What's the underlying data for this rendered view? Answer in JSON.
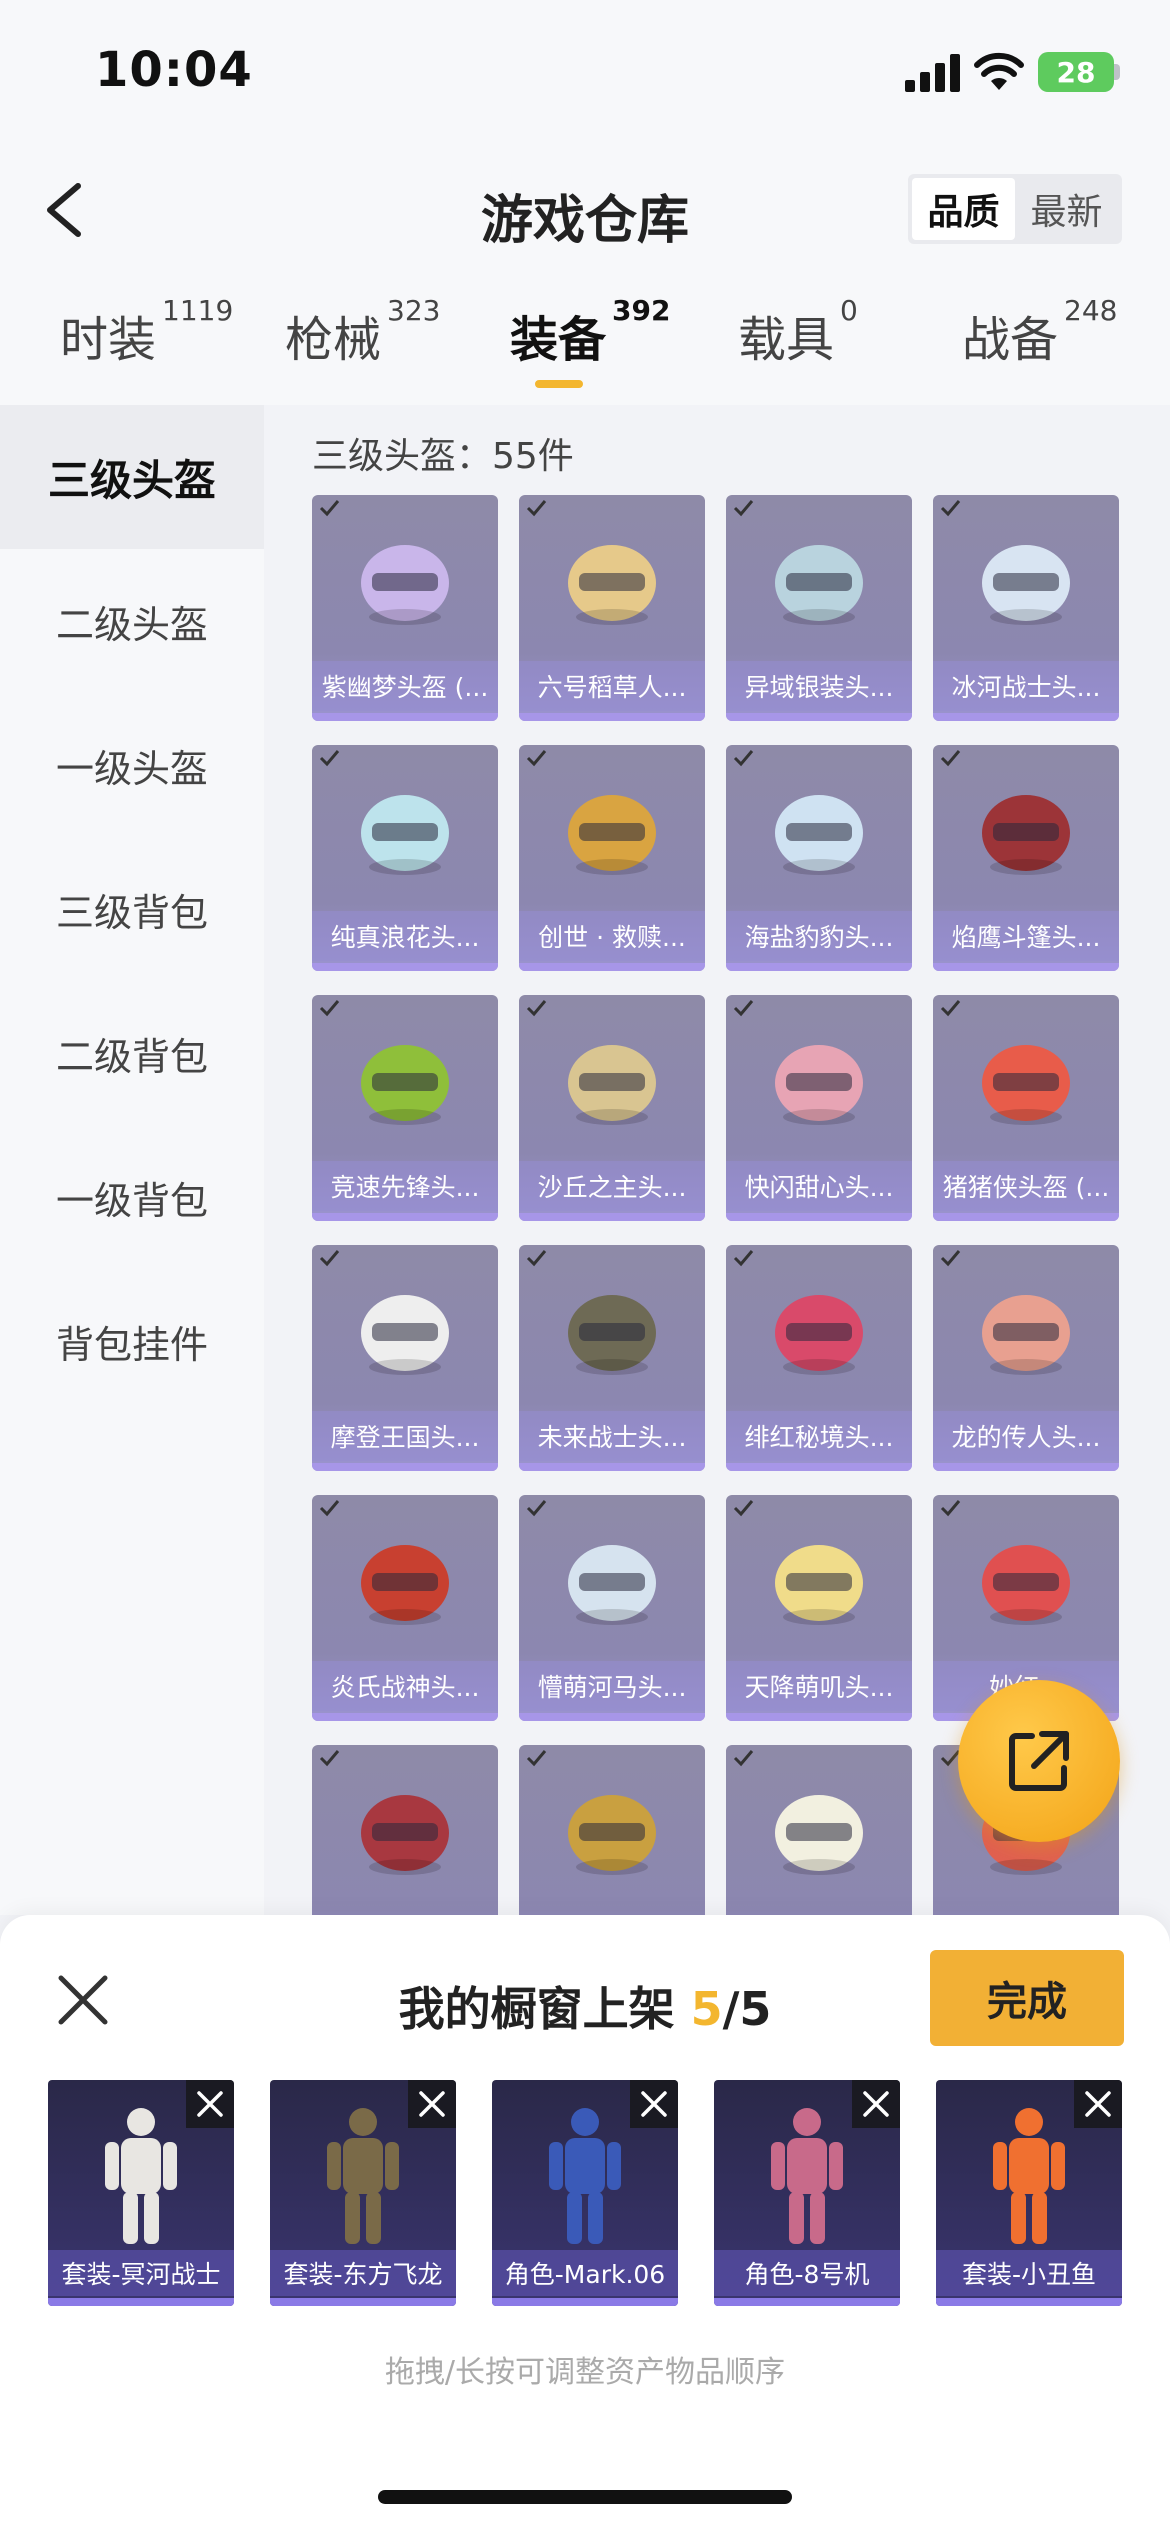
{
  "status": {
    "time": "10:04",
    "battery": "28"
  },
  "nav": {
    "title": "游戏仓库",
    "sort_options": [
      "品质",
      "最新"
    ]
  },
  "tabs": [
    {
      "label": "时装",
      "count": "1119"
    },
    {
      "label": "枪械",
      "count": "323"
    },
    {
      "label": "装备",
      "count": "392"
    },
    {
      "label": "载具",
      "count": "0"
    },
    {
      "label": "战备",
      "count": "248"
    }
  ],
  "sidebar": {
    "items": [
      "三级头盔",
      "二级头盔",
      "一级头盔",
      "三级背包",
      "二级背包",
      "一级背包",
      "背包挂件"
    ]
  },
  "content": {
    "header": "三级头盔：55件",
    "items": [
      {
        "label": "紫幽梦头盔 (...",
        "color": "#c9b6ea"
      },
      {
        "label": "六号稻草人...",
        "color": "#e6c98a"
      },
      {
        "label": "异域银装头...",
        "color": "#b9d3de"
      },
      {
        "label": "冰河战士头...",
        "color": "#d8e4f2"
      },
      {
        "label": "纯真浪花头...",
        "color": "#bde3ec"
      },
      {
        "label": "创世 · 救赎...",
        "color": "#d9a441"
      },
      {
        "label": "海盐豹豹头...",
        "color": "#cfe2f2"
      },
      {
        "label": "焰鹰斗篷头...",
        "color": "#9c3438"
      },
      {
        "label": "竞速先锋头...",
        "color": "#8fbf3a"
      },
      {
        "label": "沙丘之主头...",
        "color": "#d9c591"
      },
      {
        "label": "快闪甜心头...",
        "color": "#e7a4b4"
      },
      {
        "label": "猪猪侠头盔 (...",
        "color": "#e85c4a"
      },
      {
        "label": "摩登王国头...",
        "color": "#eeeeee"
      },
      {
        "label": "未来战士头...",
        "color": "#6e6a55"
      },
      {
        "label": "绯红秘境头...",
        "color": "#d94a6a"
      },
      {
        "label": "龙的传人头...",
        "color": "#e8a090"
      },
      {
        "label": "炎氏战神头...",
        "color": "#c84030"
      },
      {
        "label": "懵萌河马头...",
        "color": "#d6e3ef"
      },
      {
        "label": "天降萌叽头...",
        "color": "#f0dc8a"
      },
      {
        "label": "妙红...",
        "color": "#e05050"
      },
      {
        "label": "",
        "color": "#a83840"
      },
      {
        "label": "",
        "color": "#c9a040"
      },
      {
        "label": "",
        "color": "#f2f0e0"
      },
      {
        "label": "",
        "color": "#e06050"
      }
    ]
  },
  "sheet": {
    "title": "我的橱窗上架",
    "count_current": "5",
    "count_total": "/5",
    "done_label": "完成",
    "slots": [
      {
        "label": "套装-冥河战士",
        "color": "#e8e6e2"
      },
      {
        "label": "套装-东方飞龙",
        "color": "#7a6a48"
      },
      {
        "label": "角色-Mark.06",
        "color": "#3a5ab8"
      },
      {
        "label": "角色-8号机",
        "color": "#c86a8a"
      },
      {
        "label": "套装-小丑鱼",
        "color": "#f07030"
      }
    ],
    "hint": "拖拽/长按可调整资产物品顺序"
  }
}
